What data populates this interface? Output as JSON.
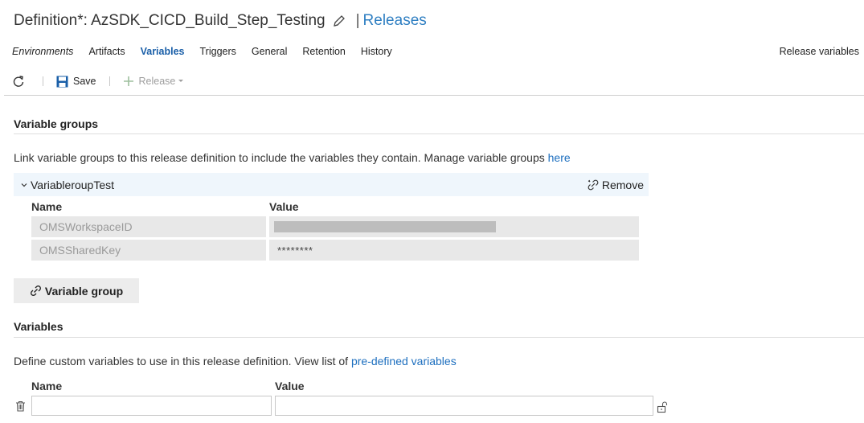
{
  "header": {
    "definition_title": "Definition*: AzSDK_CICD_Build_Step_Testing",
    "separator": "|",
    "breadcrumb_link": "Releases"
  },
  "tabs": [
    {
      "label": "Environments",
      "active": false
    },
    {
      "label": "Artifacts",
      "active": false
    },
    {
      "label": "Variables",
      "active": true
    },
    {
      "label": "Triggers",
      "active": false
    },
    {
      "label": "General",
      "active": false
    },
    {
      "label": "Retention",
      "active": false
    },
    {
      "label": "History",
      "active": false
    }
  ],
  "release_variables_link": "Release variables",
  "toolbar": {
    "refresh_icon": "refresh-icon",
    "save_label": "Save",
    "release_label": "Release"
  },
  "variable_groups": {
    "title": "Variable groups",
    "description": "Link variable groups to this release definition to include the variables they contain. Manage variable groups ",
    "manage_link": "here",
    "group": {
      "name": "VariableroupTest",
      "remove_label": "Remove",
      "columns": {
        "name": "Name",
        "value": "Value"
      },
      "rows": [
        {
          "name": "OMSWorkspaceID",
          "value": "",
          "masked_bar": true
        },
        {
          "name": "OMSSharedKey",
          "value": "********",
          "masked_bar": false
        }
      ]
    },
    "add_button_label": "Variable group"
  },
  "variables": {
    "title": "Variables",
    "description": "Define custom variables to use in this release definition. View list of ",
    "predefined_link": "pre-defined variables",
    "columns": {
      "name": "Name",
      "value": "Value"
    },
    "new_row": {
      "name": "",
      "value": ""
    }
  },
  "colors": {
    "accent": "#1a5fa8",
    "link": "#1d6fbf",
    "group_header_bg": "#eff6fc",
    "readonly_cell_bg": "#e8e8e8"
  }
}
